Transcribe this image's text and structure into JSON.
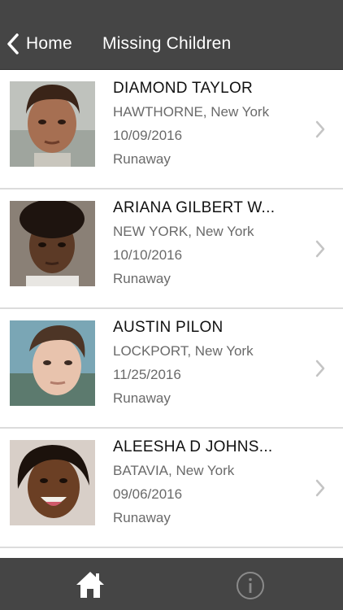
{
  "navbar": {
    "back_label": "Home",
    "title": "Missing Children",
    "back_icon": "chevron-left-icon"
  },
  "children": [
    {
      "name": "DIAMOND TAYLOR",
      "location": "HAWTHORNE, New York",
      "date": "10/09/2016",
      "status": "Runaway"
    },
    {
      "name": "ARIANA GILBERT W...",
      "location": "NEW YORK, New York",
      "date": "10/10/2016",
      "status": "Runaway"
    },
    {
      "name": "AUSTIN PILON",
      "location": "LOCKPORT, New York",
      "date": "11/25/2016",
      "status": "Runaway"
    },
    {
      "name": "ALEESHA D JOHNS...",
      "location": "BATAVIA, New York",
      "date": "09/06/2016",
      "status": "Runaway"
    }
  ],
  "tabbar": {
    "home_icon": "home-icon",
    "info_icon": "info-icon"
  },
  "colors": {
    "bar_background": "#454545",
    "name_text": "#111111",
    "detail_text": "#6a6a6a",
    "chevron": "#c4c4c4",
    "separator": "#dcdcdc"
  }
}
